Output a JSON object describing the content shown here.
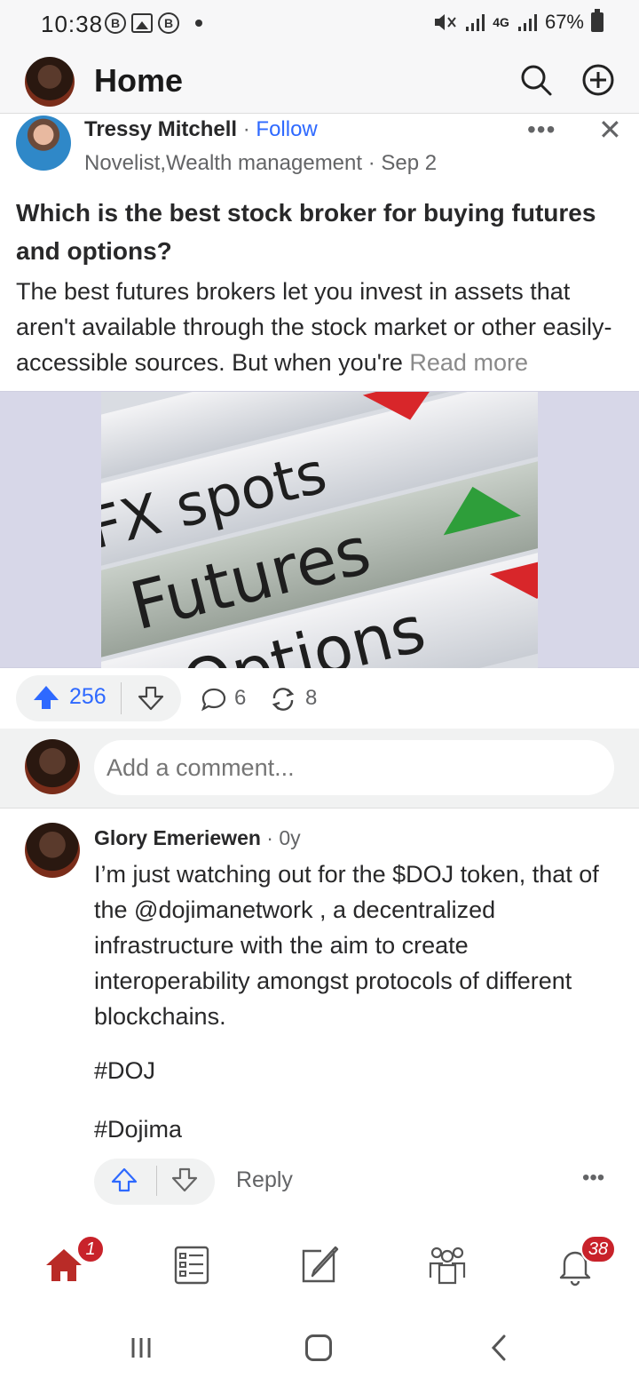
{
  "status_bar": {
    "time": "10:38",
    "network": "4G",
    "battery": "67%"
  },
  "header": {
    "title": "Home",
    "icons": [
      "avatar",
      "search-icon",
      "add-icon"
    ]
  },
  "post": {
    "author": "Tressy Mitchell",
    "follow_label": "Follow",
    "credential": "Novelist,Wealth management",
    "date": "Sep 2",
    "title": "Which is the best stock broker for buying futures and options?",
    "body": "The best futures brokers let you invest in assets that aren't available through the stock market or other easily-accessible sources. But when you're",
    "read_more": "Read more",
    "image_labels": [
      "FX spots",
      "Futures",
      "Options"
    ],
    "upvotes": "256",
    "comments": "6",
    "shares": "8"
  },
  "add_comment": {
    "placeholder": "Add a comment..."
  },
  "comment": {
    "author": "Glory Emeriewen",
    "time": "0y",
    "text": "I’m just watching out for the $DOJ token, that of the @dojimanetwork , a decentralized infrastructure with the aim to create interoperability amongst protocols of different blockchains.",
    "hashtag_1": "#DOJ",
    "hashtag_2": "#Dojima",
    "reply_label": "Reply"
  },
  "bottom_nav": {
    "home_badge": "1",
    "notifications_badge": "38",
    "items": [
      "home-icon",
      "answer-icon",
      "write-icon",
      "spaces-icon",
      "bell-icon"
    ]
  },
  "colors": {
    "accent_blue": "#2e69ff",
    "quora_red": "#c8222a",
    "text": "#282829",
    "muted": "#636466"
  }
}
